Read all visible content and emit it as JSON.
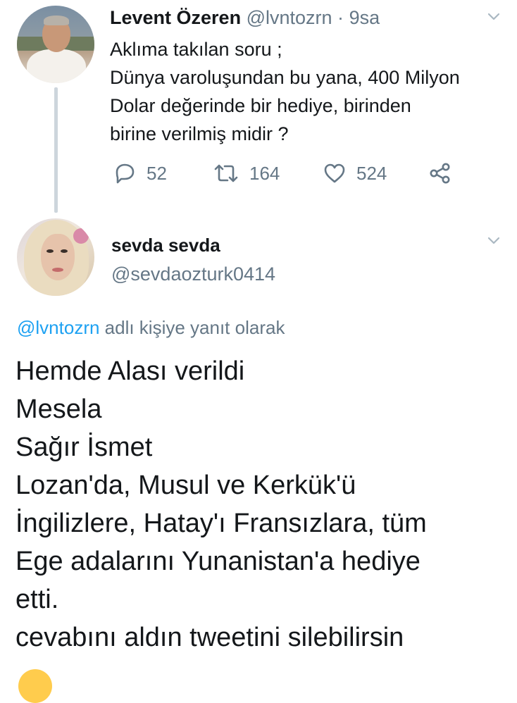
{
  "parent_tweet": {
    "author_name": "Levent Özeren",
    "author_handle": "@lvntozrn",
    "separator": "·",
    "time": "9sa",
    "text_lines": [
      "Aklıma takılan soru ;",
      "Dünya varoluşundan bu yana, 400 Milyon",
      "Dolar değerinde bir hediye, birinden",
      "birine verilmiş midir ?"
    ],
    "actions": {
      "reply_count": "52",
      "retweet_count": "164",
      "like_count": "524"
    }
  },
  "reply_tweet": {
    "author_name": "sevda sevda",
    "author_handle": "@sevdaozturk0414",
    "reply_to_mention": "@lvntozrn",
    "reply_to_text": " adlı kişiye yanıt olarak",
    "text_lines": [
      "Hemde Alası verildi",
      "Mesela",
      "Sağır İsmet",
      "Lozan'da, Musul ve Kerkük'ü",
      "İngilizlere, Hatay'ı Fransızlara, tüm",
      "Ege adalarını Yunanistan'a hediye",
      "etti.",
      "cevabını aldın tweetini silebilirsin"
    ]
  },
  "icons": {
    "reply": "reply-icon",
    "retweet": "retweet-icon",
    "like": "heart-icon",
    "share": "share-icon",
    "menu": "chevron-down-icon"
  },
  "colors": {
    "text": "#14171a",
    "muted": "#657786",
    "link": "#1da1f2",
    "thread_line": "#cdd5dc"
  }
}
